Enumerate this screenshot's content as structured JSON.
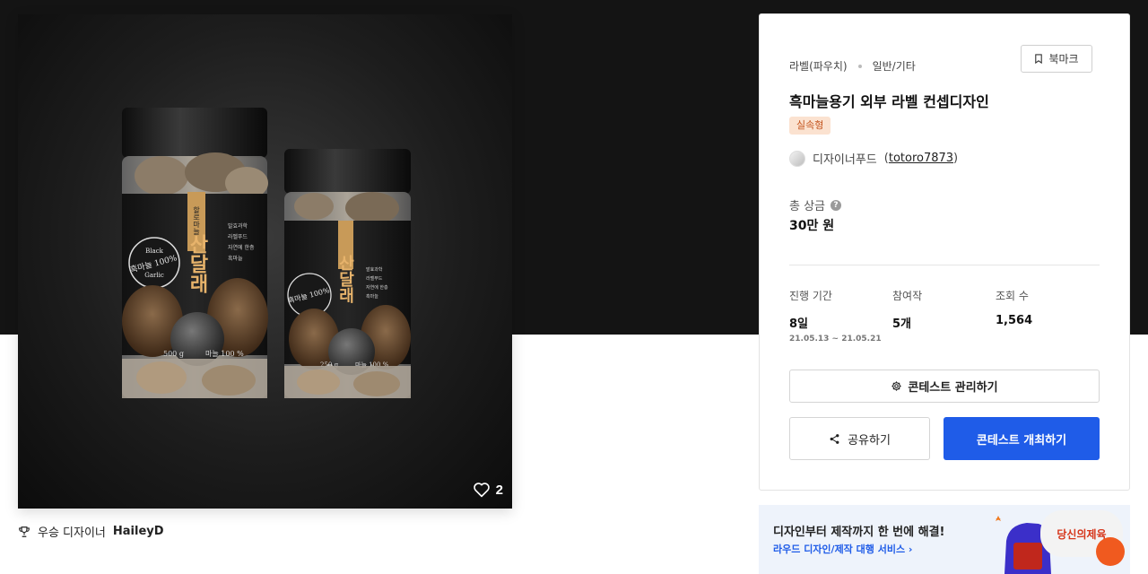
{
  "hero": {
    "likes": "2",
    "label_text": {
      "brand_tag": "할로마늘",
      "product_name": "산달래",
      "seal": "흑마늘 100%",
      "seal_top": "Black",
      "seal_bottom": "Garlic",
      "features": [
        "발효과학",
        "라벨푸드",
        "자연에 한층",
        "흑마늘"
      ],
      "large_weight": "500 g",
      "small_weight": "250 g",
      "content": "마늘 100 %"
    }
  },
  "winner": {
    "prefix": "우승 디자이너",
    "name": "HaileyD"
  },
  "card": {
    "category": "라벨(파우치)",
    "subcategory": "일반/기타",
    "bookmark_label": "북마크",
    "title": "흑마늘용기 외부 라벨 컨셉디자인",
    "badge": "실속형",
    "designer_name": "디자이너푸드",
    "designer_id_open": "(",
    "designer_id": "totoro7873",
    "designer_id_close": ")",
    "prize_label": "총 상금",
    "help_mark": "?",
    "prize_value": "30만 원",
    "stats": [
      {
        "label": "진행 기간",
        "value": "8일",
        "sub": "21.05.13 ~ 21.05.21"
      },
      {
        "label": "참여작",
        "value": "5개"
      },
      {
        "label": "조회 수",
        "value": "1,564"
      }
    ],
    "manage_label": "콘테스트 관리하기",
    "share_label": "공유하기",
    "host_label": "콘테스트 개최하기"
  },
  "ad": {
    "title": "디자인부터 제작까지 한 번에 해결!",
    "link": "라우드 디자인/제작 대행 서비스",
    "link_chevron": "›",
    "brand": "당신의제육"
  },
  "colors": {
    "primary": "#1f5ce8",
    "badge_bg": "#fbe2d0",
    "badge_text": "#c4551f",
    "dark_band": "#141414",
    "accent_orange": "#f05a1f"
  },
  "icons": [
    "heart-icon",
    "trophy-icon",
    "bookmark-icon",
    "help-icon",
    "gear-icon",
    "share-icon",
    "chevron-right-icon"
  ]
}
